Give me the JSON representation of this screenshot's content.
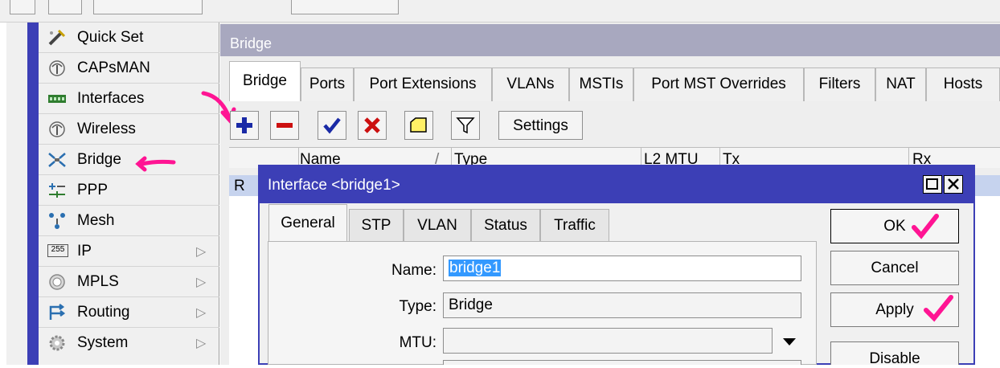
{
  "menu": {
    "items": [
      {
        "label": "Quick Set",
        "icon": "quick-set-icon",
        "submenu": false
      },
      {
        "label": "CAPsMAN",
        "icon": "capsman-icon",
        "submenu": false
      },
      {
        "label": "Interfaces",
        "icon": "interfaces-icon",
        "submenu": false
      },
      {
        "label": "Wireless",
        "icon": "wireless-icon",
        "submenu": false
      },
      {
        "label": "Bridge",
        "icon": "bridge-icon",
        "submenu": false
      },
      {
        "label": "PPP",
        "icon": "ppp-icon",
        "submenu": false
      },
      {
        "label": "Mesh",
        "icon": "mesh-icon",
        "submenu": false
      },
      {
        "label": "IP",
        "icon": "ip-icon",
        "submenu": true
      },
      {
        "label": "MPLS",
        "icon": "mpls-icon",
        "submenu": true
      },
      {
        "label": "Routing",
        "icon": "routing-icon",
        "submenu": true
      },
      {
        "label": "System",
        "icon": "system-icon",
        "submenu": true
      }
    ],
    "submenu_arrow": "▷",
    "ip_icon_text": "255"
  },
  "bridge_window": {
    "title": "Bridge",
    "tabs": [
      "Bridge",
      "Ports",
      "Port Extensions",
      "VLANs",
      "MSTIs",
      "Port MST Overrides",
      "Filters",
      "NAT",
      "Hosts"
    ],
    "active_tab": "Bridge",
    "toolbar": {
      "settings_label": "Settings"
    },
    "columns": [
      "Name",
      "Type",
      "L2 MTU",
      "Tx",
      "Rx"
    ],
    "sort_indicator": "/",
    "rows": [
      {
        "flag": "R"
      }
    ]
  },
  "dialog": {
    "title": "Interface <bridge1>",
    "tabs": [
      "General",
      "STP",
      "VLAN",
      "Status",
      "Traffic"
    ],
    "active_tab": "General",
    "fields": {
      "name_label": "Name:",
      "name_value": "bridge1",
      "type_label": "Type:",
      "type_value": "Bridge",
      "mtu_label": "MTU:",
      "mtu_value": ""
    },
    "buttons": {
      "ok": "OK",
      "cancel": "Cancel",
      "apply": "Apply",
      "disable": "Disable"
    }
  },
  "colors": {
    "title_blue": "#3c3fb6",
    "annotation_pink": "#ff1493",
    "selection_blue": "#3399ff"
  }
}
